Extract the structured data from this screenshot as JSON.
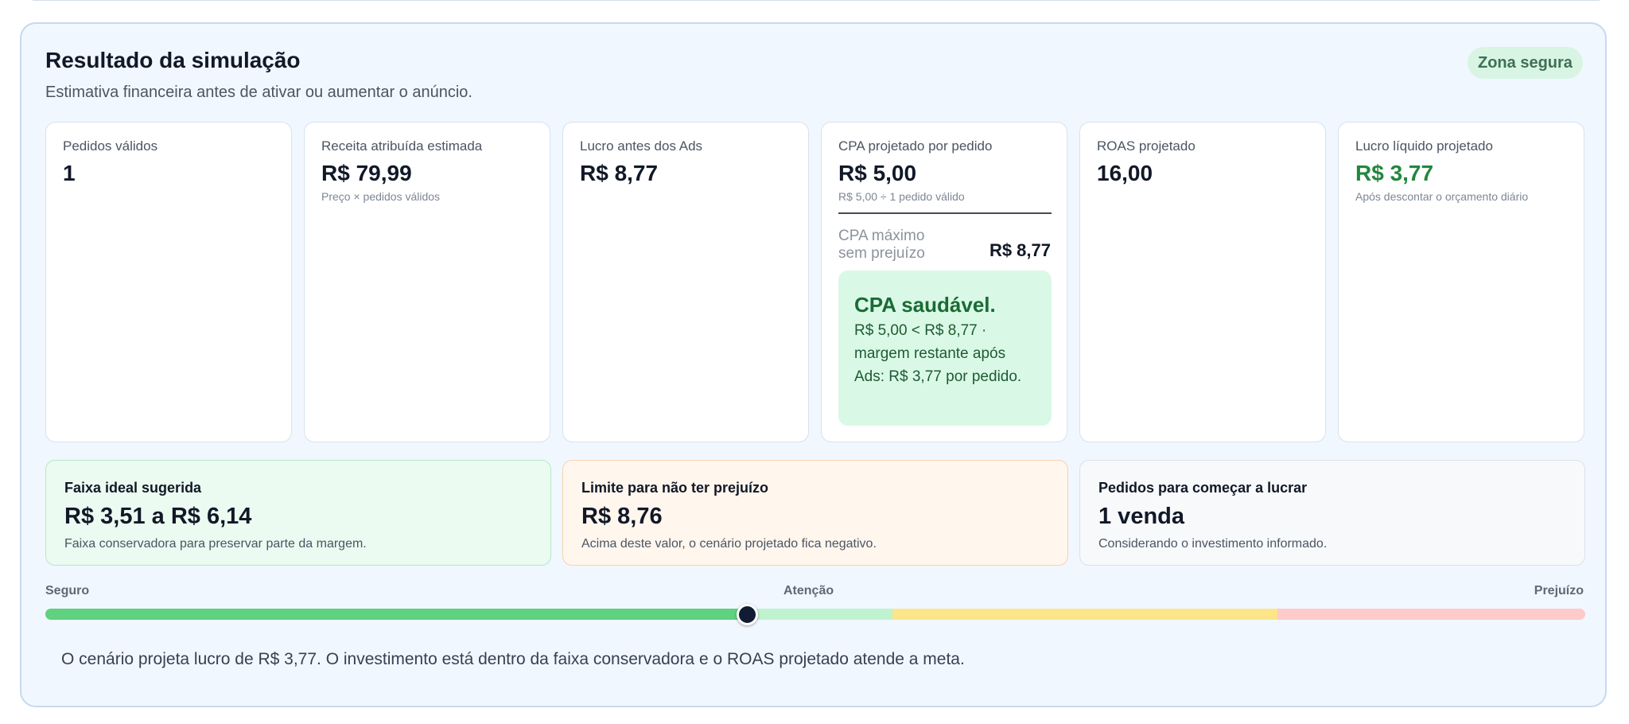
{
  "header": {
    "title": "Resultado da simulação",
    "subtitle": "Estimativa financeira antes de ativar ou aumentar o anúncio.",
    "status_badge": "Zona segura"
  },
  "metrics": {
    "pedidos_validos": {
      "label": "Pedidos válidos",
      "value": "1"
    },
    "receita": {
      "label": "Receita atribuída estimada",
      "value": "R$ 79,99",
      "sub": "Preço × pedidos válidos"
    },
    "lucro_antes_ads": {
      "label": "Lucro antes dos Ads",
      "value": "R$ 8,77"
    },
    "cpa": {
      "label": "CPA projetado por pedido",
      "value": "R$ 5,00",
      "sub": "R$ 5,00 ÷ 1 pedido válido",
      "max_label": "CPA máximo sem prejuízo",
      "max_value": "R$ 8,77",
      "health_title": "CPA saudável.",
      "health_text": "R$ 5,00 < R$ 8,77 · margem restante após Ads: R$ 3,77 por pedido."
    },
    "roas": {
      "label": "ROAS projetado",
      "value": "16,00"
    },
    "lucro_liquido": {
      "label": "Lucro líquido projetado",
      "value": "R$ 3,77",
      "sub": "Após descontar o orçamento diário"
    }
  },
  "ranges": {
    "ideal": {
      "label": "Faixa ideal sugerida",
      "value": "R$ 3,51 a R$ 6,14",
      "sub": "Faixa conservadora para preservar parte da margem."
    },
    "limite": {
      "label": "Limite para não ter prejuízo",
      "value": "R$ 8,76",
      "sub": "Acima deste valor, o cenário projetado fica negativo."
    },
    "pedidos": {
      "label": "Pedidos para começar a lucrar",
      "value": "1 venda",
      "sub": "Considerando o investimento informado."
    }
  },
  "scale": {
    "labels": {
      "safe": "Seguro",
      "attention": "Atenção",
      "loss": "Prejuízo"
    },
    "position_fraction": 0.456,
    "segments": [
      {
        "name": "safe",
        "fraction": 0.456,
        "color": "#5fd17f"
      },
      {
        "name": "safe-margin",
        "fraction": 0.094,
        "color": "#bff3cf"
      },
      {
        "name": "attention",
        "fraction": 0.25,
        "color": "#fde58a"
      },
      {
        "name": "loss",
        "fraction": 0.2,
        "color": "#fecaca"
      }
    ]
  },
  "summary": "O cenário projeta lucro de R$ 3,77. O investimento está dentro da faixa conservadora e o ROAS projetado atende a meta."
}
